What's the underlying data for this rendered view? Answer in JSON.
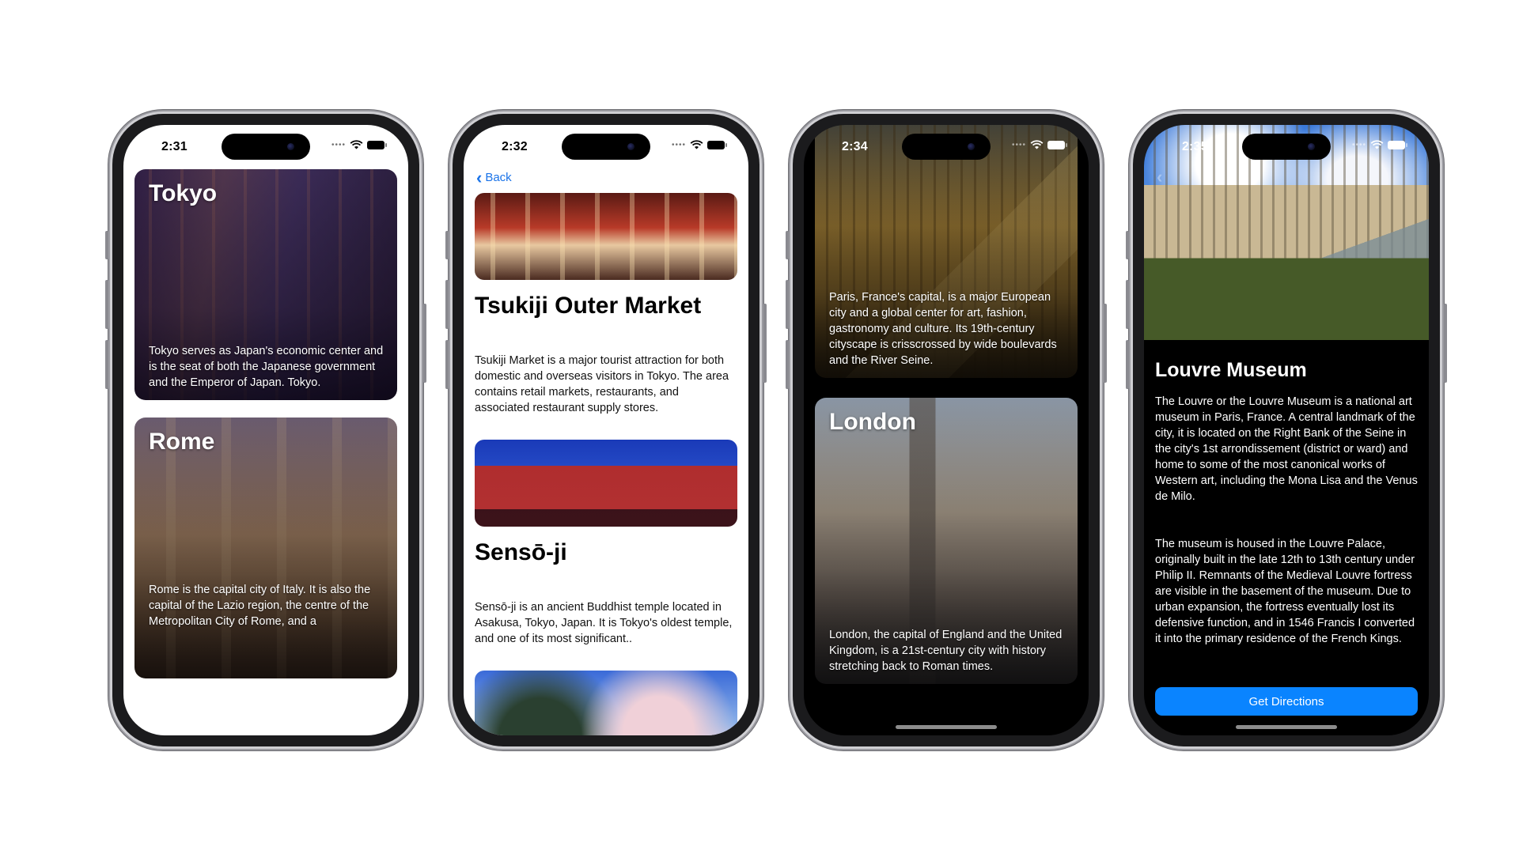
{
  "phones": {
    "p1": {
      "time": "2:31",
      "cards": [
        {
          "title": "Tokyo",
          "text": "Tokyo serves as Japan's economic center and is the seat of both the Japanese government and the Emperor of Japan. Tokyo."
        },
        {
          "title": "Rome",
          "text": "Rome is the capital city of Italy. It is also the capital of the Lazio region, the centre of the Metropolitan City of Rome, and a"
        }
      ]
    },
    "p2": {
      "time": "2:32",
      "back_label": "Back",
      "places": [
        {
          "title": "Tsukiji Outer Market",
          "text": "Tsukiji Market is a major tourist attraction for both domestic and overseas visitors in Tokyo. The area contains retail markets, restaurants, and associated restaurant supply stores."
        },
        {
          "title": "Sensō-ji",
          "text": "Sensō-ji is an ancient Buddhist temple located in Asakusa, Tokyo, Japan. It is Tokyo's oldest temple, and one of its most significant.."
        }
      ]
    },
    "p3": {
      "time": "2:34",
      "cards": [
        {
          "text": "Paris, France's capital, is a major European city and a global center for art, fashion, gastronomy and culture. Its 19th-century cityscape is crisscrossed by wide boulevards and the River Seine."
        },
        {
          "title": "London",
          "text": "London, the capital of England and the United Kingdom, is a 21st-century city with history stretching back to Roman times."
        }
      ]
    },
    "p4": {
      "time": "2:35",
      "title": "Louvre Museum",
      "paragraphs": [
        "The Louvre or the Louvre Museum is a national art museum in Paris, France. A central landmark of the city, it is located on the Right Bank of the Seine in the city's 1st arrondissement (district or ward) and home to some of the most canonical works of Western art, including the Mona Lisa and the Venus de Milo.",
        "The museum is housed in the Louvre Palace, originally built in the late 12th to 13th century under Philip II. Remnants of the Medieval Louvre fortress are visible in the basement of the museum. Due to urban expansion, the fortress eventually lost its defensive function, and in 1546 Francis I converted it into the primary residence of the French Kings."
      ],
      "button_label": "Get Directions"
    }
  },
  "colors": {
    "accent": "#0a84ff",
    "link": "#1a73e8"
  }
}
